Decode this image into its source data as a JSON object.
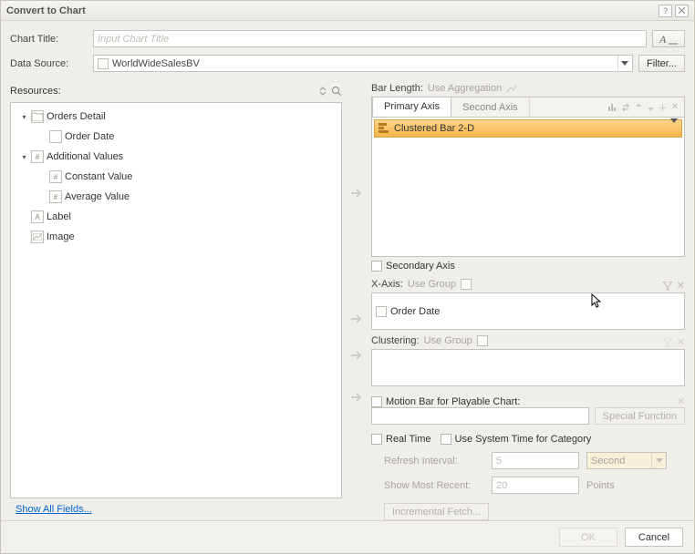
{
  "window": {
    "title": "Convert to Chart"
  },
  "form": {
    "chart_title_label": "Chart Title:",
    "chart_title_placeholder": "Input Chart Title",
    "data_source_label": "Data Source:",
    "data_source_value": "WorldWideSalesBV",
    "filter_btn": "Filter..."
  },
  "resources": {
    "label": "Resources:",
    "tree": [
      {
        "level": 0,
        "expander": "▾",
        "icon": "folder",
        "label": "Orders Detail"
      },
      {
        "level": 1,
        "expander": "",
        "icon": "field",
        "label": "Order Date"
      },
      {
        "level": 0,
        "expander": "▾",
        "icon": "hash",
        "label": "Additional Values"
      },
      {
        "level": 1,
        "expander": "",
        "icon": "hash",
        "label": "Constant Value"
      },
      {
        "level": 1,
        "expander": "",
        "icon": "hash",
        "label": "Average Value"
      },
      {
        "level": 0,
        "expander": "",
        "icon": "A",
        "label": "Label"
      },
      {
        "level": 0,
        "expander": "",
        "icon": "img",
        "label": "Image"
      }
    ],
    "show_all": "Show All Fields..."
  },
  "right": {
    "bar_length_label": "Bar Length:",
    "bar_length_hint": "Use Aggregation",
    "tabs": {
      "primary": "Primary Axis",
      "secondary": "Second Axis"
    },
    "series_type": "Clustered Bar 2-D",
    "secondary_axis_cb": "Secondary Axis",
    "xaxis_label": "X-Axis:",
    "xaxis_hint": "Use Group",
    "xaxis_value": "Order Date",
    "clustering_label": "Clustering:",
    "clustering_hint": "Use Group",
    "motion_cb": "Motion Bar for Playable Chart:",
    "special_fn": "Special Function",
    "realtime_cb": "Real Time",
    "system_time_cb": "Use System Time for Category",
    "refresh_label": "Refresh Interval:",
    "refresh_value": "5",
    "refresh_unit": "Second",
    "recent_label": "Show Most Recent:",
    "recent_value": "20",
    "recent_unit": "Points",
    "incremental": "Incremental Fetch..."
  },
  "footer": {
    "ok": "OK",
    "cancel": "Cancel"
  }
}
